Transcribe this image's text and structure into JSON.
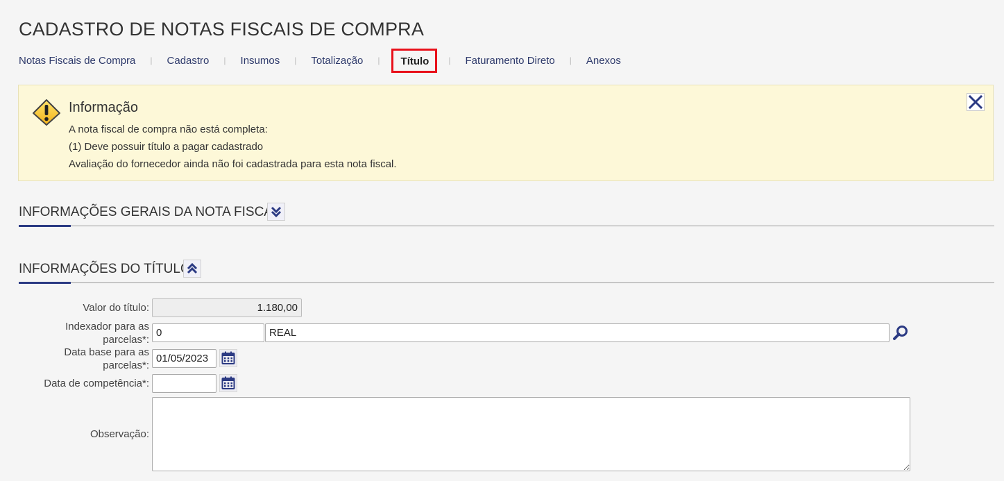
{
  "page": {
    "title": "CADASTRO DE NOTAS FISCAIS DE COMPRA"
  },
  "tabs": [
    {
      "label": "Notas Fiscais de Compra"
    },
    {
      "label": "Cadastro"
    },
    {
      "label": "Insumos"
    },
    {
      "label": "Totalização"
    },
    {
      "label": "Título",
      "active": true
    },
    {
      "label": "Faturamento Direto"
    },
    {
      "label": "Anexos"
    }
  ],
  "alert": {
    "title": "Informação",
    "lines": [
      "A nota fiscal de compra não está completa:",
      "(1) Deve possuir título a pagar cadastrado",
      "Avaliação do fornecedor ainda não foi cadastrada para esta nota fiscal."
    ],
    "icon": "warning-icon",
    "close_icon": "close-icon"
  },
  "sections": {
    "general": {
      "title": "INFORMAÇÕES GERAIS DA NOTA FISCAL",
      "icon": "chevron-double-down-icon"
    },
    "titulo": {
      "title": "INFORMAÇÕES DO TÍTULO",
      "icon": "chevron-double-up-icon"
    }
  },
  "form": {
    "valor": {
      "label": "Valor do título:",
      "value": "1.180,00"
    },
    "indexador": {
      "label_line1": "Indexador para as",
      "label_line2": "parcelas*:",
      "code": "0",
      "description": "REAL",
      "icon": "search-icon"
    },
    "data_base": {
      "label_line1": "Data base para as",
      "label_line2": "parcelas*:",
      "value": "01/05/2023",
      "icon": "calendar-icon"
    },
    "competencia": {
      "label": "Data de competência*:",
      "value": "",
      "icon": "calendar-icon"
    },
    "observacao": {
      "label": "Observação:",
      "value": ""
    }
  },
  "colors": {
    "accent": "#2b3a83",
    "alert_bg": "#fdf8d8",
    "highlight": "#e8101a",
    "link": "#2e3a6b"
  }
}
